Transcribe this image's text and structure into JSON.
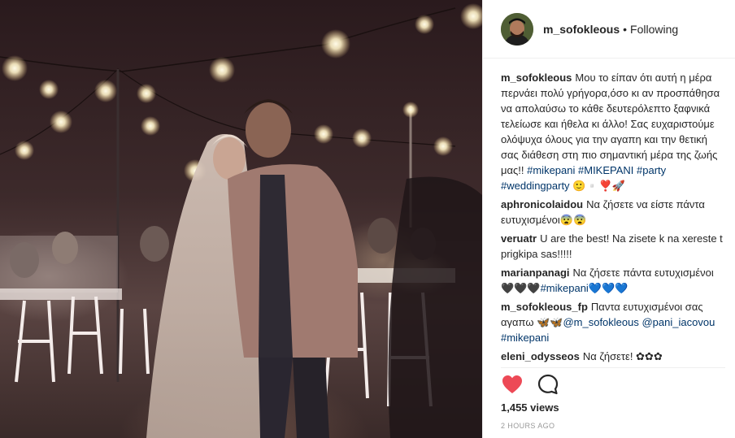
{
  "post": {
    "username": "m_sofokleous",
    "separator": "•",
    "follow_status": "Following",
    "views": "1,455 views",
    "time_ago": "2 HOURS AGO"
  },
  "caption": {
    "username": "m_sofokleous",
    "text": "Μου το είπαν ότι αυτή η μέρα περνάει πολύ γρήγορα,όσο κι αν προσπάθησα να απολαύσω το κάθε δευτερόλεπτο ξαφνικά τελείωσε και ήθελα κι άλλο! Σας ευχαριστούμε ολόψυχα όλους για την αγαπη και την θετική σας διάθεση στη πιο σημαντική μέρα της ζωής μας!!",
    "tags": [
      "#mikepani",
      "#MIKEPANI",
      "#party",
      "#weddingparty"
    ],
    "emoji": "🙂▫️❣️🚀"
  },
  "comments": [
    {
      "username": "aphronicolaidou",
      "text": "Να ζήσετε να είστε πάντα ευτυχισμένοι😨😨"
    },
    {
      "username": "veruatr",
      "text": "U are the best! Na zisete k na xereste t prigkipa sas!!!!!"
    },
    {
      "username": "marianpanagi",
      "text": "Να ζήσετε πάντα ευτυχισμένοι 🖤🖤🖤",
      "tag": "#mikepani",
      "suffix": "💙💙💙"
    },
    {
      "username": "m_sofokleous_fp",
      "text": "Παντα ευτυχισμένοι σας αγαπω 🦋🦋",
      "mention1": "@m_sofokleous",
      "mention2": "@pani_iacovou",
      "tag": "#mikepani"
    },
    {
      "username": "eleni_odysseos",
      "text": "Να ζήσετε! ✿✿✿"
    }
  ],
  "icons": {
    "like": "heart-icon",
    "comment": "comment-bubble-icon",
    "avatar": "profile-avatar"
  },
  "colors": {
    "heart": "#ed4956",
    "link": "#003569",
    "muted": "#999999"
  }
}
